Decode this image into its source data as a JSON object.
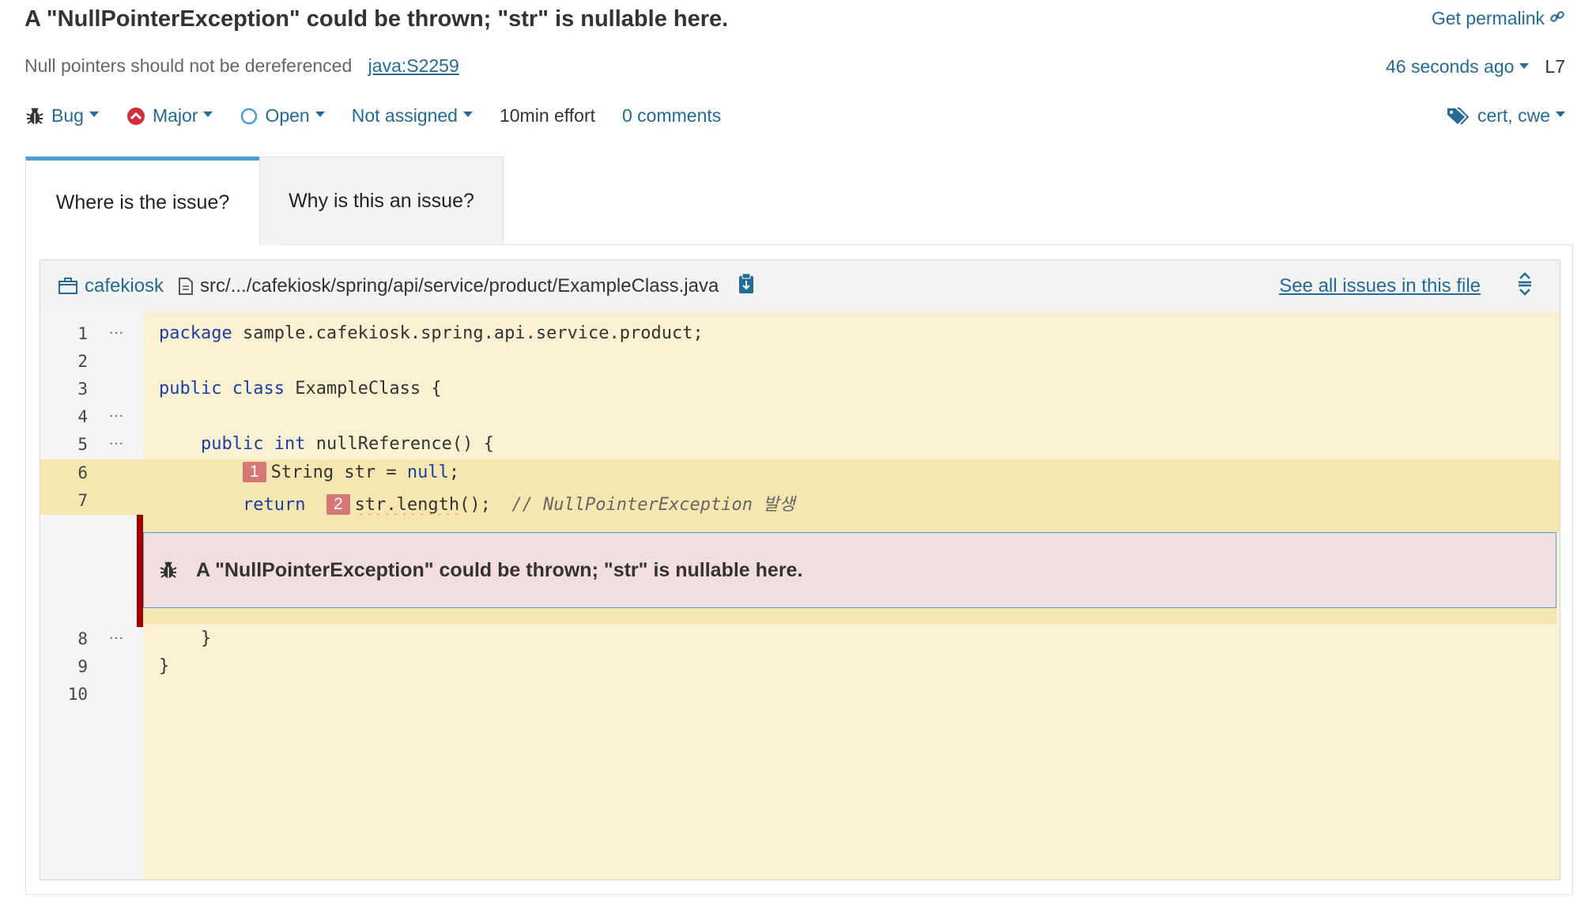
{
  "issue": {
    "title": "A \"NullPointerException\" could be thrown; \"str\" is nullable here.",
    "permalink_label": "Get permalink",
    "rule_name": "Null pointers should not be dereferenced",
    "rule_key": "java:S2259",
    "age": "46 seconds ago",
    "line_ref": "L7",
    "type": "Bug",
    "severity": "Major",
    "status": "Open",
    "assignee": "Not assigned",
    "effort": "10min effort",
    "comments": "0 comments",
    "tags": "cert, cwe"
  },
  "tabs": [
    {
      "label": "Where is the issue?",
      "active": true
    },
    {
      "label": "Why is this an issue?",
      "active": false
    }
  ],
  "viewer": {
    "project": "cafekiosk",
    "file_path": "src/.../cafekiosk/spring/api/service/product/ExampleClass.java",
    "see_all_label": "See all issues in this file",
    "line_numbers": [
      "1",
      "2",
      "3",
      "4",
      "5",
      "6",
      "7",
      "8",
      "9",
      "10"
    ],
    "dots": "…",
    "code": {
      "l1_kw": "package",
      "l1_rest": " sample.cafekiosk.spring.api.service.product;",
      "l3_kw": "public class",
      "l3_rest": " ExampleClass {",
      "l5_indent": "    ",
      "l5_kw1": "public",
      "l5_kw2": "int",
      "l5_rest": " nullReference() {",
      "l6_indent": "        ",
      "l6_marker": "1",
      "l6_pre": "String str = ",
      "l6_kw": "null",
      "l6_post": ";",
      "l7_indent": "        ",
      "l7_kw": "return",
      "l7_marker": "2",
      "l7_call": "str.length",
      "l7_post": "();  ",
      "l7_comment": "// NullPointerException 발생",
      "l8": "    }",
      "l9": "}"
    },
    "issue_message": "A \"NullPointerException\" could be thrown; \"str\" is nullable here."
  },
  "colors": {
    "link": "#236a97",
    "code_bg": "#faf1d3",
    "highlight_bg": "#f6e7b1",
    "issue_bg": "#f2dede",
    "issue_bar": "#a40000",
    "marker_bg": "#d67777",
    "tab_accent": "#4b9fd5"
  }
}
